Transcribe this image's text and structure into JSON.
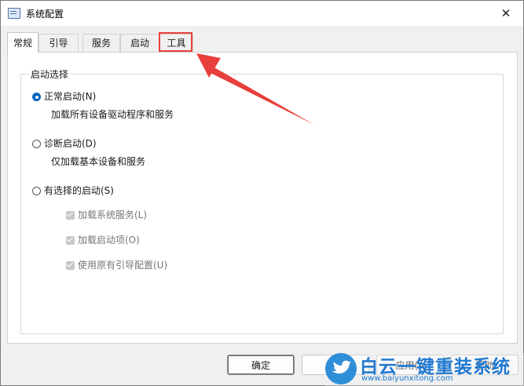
{
  "window": {
    "title": "系统配置",
    "close_glyph": "✕"
  },
  "tabs": [
    {
      "label": "常规",
      "active": true
    },
    {
      "label": "引导",
      "active": false
    },
    {
      "label": "服务",
      "active": false
    },
    {
      "label": "启动",
      "active": false
    },
    {
      "label": "工具",
      "active": false
    }
  ],
  "startup_selection": {
    "group_title": "启动选择",
    "normal": {
      "label": "正常启动(N)",
      "desc": "加载所有设备驱动程序和服务",
      "checked": true
    },
    "diagnostic": {
      "label": "诊断启动(D)",
      "desc": "仅加载基本设备和服务",
      "checked": false
    },
    "selective": {
      "label": "有选择的启动(S)",
      "checked": false,
      "options": [
        {
          "label": "加载系统服务(L)",
          "checked": true,
          "disabled": true
        },
        {
          "label": "加载启动项(O)",
          "checked": true,
          "disabled": true
        },
        {
          "label": "使用原有引导配置(U)",
          "checked": true,
          "disabled": true
        }
      ]
    }
  },
  "buttons": {
    "ok": "确定",
    "cancel": "",
    "apply": "应用(A",
    "help": "帮助"
  },
  "annotation": {
    "highlight_color": "#e8403d",
    "highlighted_tab": "工具"
  },
  "watermark": {
    "title": "白云一键重装系统",
    "url": "www.baiyunxitong.com"
  },
  "icons": {
    "app": "msconfig-icon",
    "close": "close-icon",
    "watermark": "bird-icon"
  }
}
